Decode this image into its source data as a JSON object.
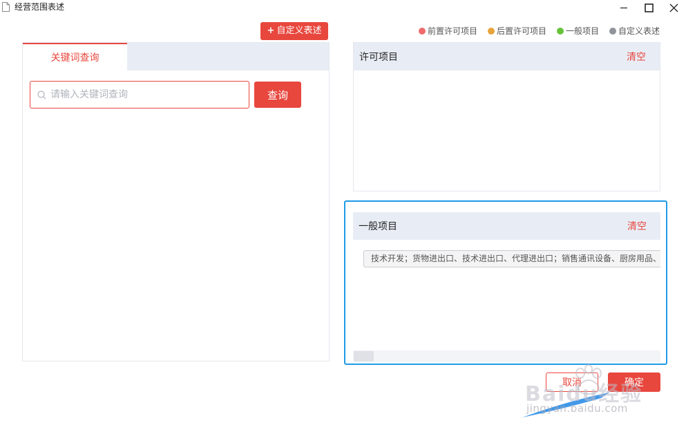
{
  "window": {
    "title": "经营范围表述"
  },
  "toolbar": {
    "custom_button_label": "自定义表述",
    "custom_button_plus": "+"
  },
  "legend": [
    {
      "label": "前置许可项目",
      "color": "#ef6b6b"
    },
    {
      "label": "后置许可项目",
      "color": "#e8a43c"
    },
    {
      "label": "一般项目",
      "color": "#67c23a"
    },
    {
      "label": "自定义表述",
      "color": "#909399"
    }
  ],
  "left_panel": {
    "tab_label": "关键词查询",
    "search": {
      "placeholder": "请输入关键词查询",
      "value": ""
    },
    "query_button": "查询"
  },
  "permit_section": {
    "title": "许可项目",
    "clear_label": "清空"
  },
  "general_section": {
    "title": "一般项目",
    "clear_label": "清空",
    "tag_text": "技术开发；货物进出口、技术进出口、代理进出口；销售通讯设备、厨房用品、"
  },
  "footer": {
    "cancel_label": "取消",
    "confirm_label": "确定"
  },
  "watermark": {
    "brand": "Baidu经验",
    "url": "jingyan.baidu.com"
  },
  "colors": {
    "accent": "#e8473e",
    "focus_border": "#1e9be8",
    "header_bg": "#e8edf5"
  }
}
